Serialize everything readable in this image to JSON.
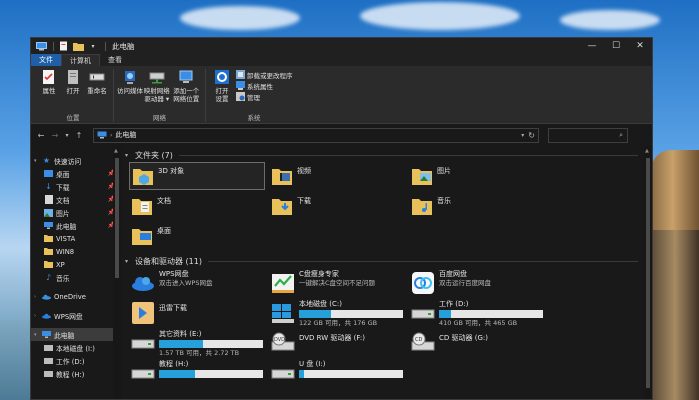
{
  "window": {
    "title": "此电脑",
    "minimize": "—",
    "maximize": "☐",
    "close": "✕"
  },
  "ribbon_tabs": [
    "文件",
    "计算机",
    "查看"
  ],
  "ribbon": {
    "location": {
      "label": "位置",
      "buttons": [
        "属性",
        "打开",
        "重命名"
      ]
    },
    "network": {
      "label": "网络",
      "buttons": [
        "访问媒体",
        "映射网络\n驱动器 ▾",
        "添加一个\n网络位置"
      ]
    },
    "system": {
      "label": "系统",
      "open_settings": "打开\n设置",
      "small": [
        "卸载或更改程序",
        "系统属性",
        "管理"
      ]
    }
  },
  "nav": {
    "back": "←",
    "forward": "→",
    "recent": "▾",
    "up": "↑",
    "address": "此电脑",
    "refresh": "↻",
    "search_icon": "⌕"
  },
  "sidebar": {
    "quick_access": "快速访问",
    "quick_items": [
      "桌面",
      "下载",
      "文档",
      "图片",
      "此电脑",
      "VISTA",
      "WIN8",
      "XP",
      "音乐"
    ],
    "onedrive": "OneDrive",
    "wps": "WPS网盘",
    "this_pc": "此电脑",
    "drives": [
      "本地磁盘 (I:)",
      "工作 (D:)",
      "教程 (H:)"
    ]
  },
  "sections": {
    "folders_title": "文件夹 (7)",
    "devices_title": "设备和驱动器 (11)"
  },
  "folders": [
    "3D 对象",
    "视频",
    "图片",
    "文档",
    "下载",
    "音乐",
    "桌面"
  ],
  "drives": [
    {
      "name": "WPS网盘",
      "sub": "双击进入WPS网盘"
    },
    {
      "name": "C盘瘦身专家",
      "sub": "一键解决C盘空间不足问题"
    },
    {
      "name": "百度网盘",
      "sub": "双击运行百度网盘"
    },
    {
      "name": "迅雷下载",
      "sub": ""
    },
    {
      "name": "本地磁盘 (C:)",
      "sub": "122 GB 可用，共 176 GB",
      "used": 0.31
    },
    {
      "name": "工作 (D:)",
      "sub": "410 GB 可用，共 465 GB",
      "used": 0.12
    },
    {
      "name": "其它资料 (E:)",
      "sub": "1.57 TB 可用，共 2.72 TB",
      "used": 0.42
    },
    {
      "name": "DVD RW 驱动器 (F:)",
      "sub": ""
    },
    {
      "name": "CD 驱动器 (G:)",
      "sub": ""
    },
    {
      "name": "教程 (H:)",
      "sub": "",
      "used": 0.35
    },
    {
      "name": "U 盘 (I:)",
      "sub": "",
      "used": 0.05
    }
  ],
  "colors": {
    "accent": "#1f5fa8",
    "bar_fill": "#26a0da",
    "bar_bg": "#e6e6e6"
  }
}
